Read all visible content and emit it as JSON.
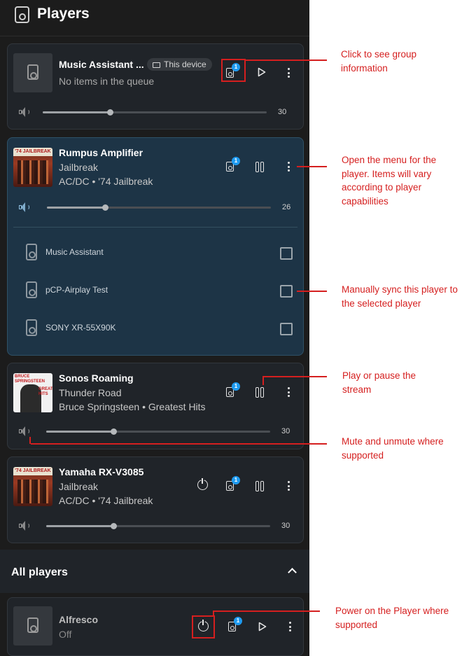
{
  "header": {
    "title": "Players",
    "icon": "speaker-icon"
  },
  "cards": [
    {
      "id": "ma",
      "name": "Music Assistant ...",
      "chip": "This device",
      "line2": "No items in the queue",
      "group_badge": "1",
      "volume": 30,
      "volume_text": "30",
      "state": "idle"
    },
    {
      "id": "rumpus",
      "name": "Rumpus Amplifier",
      "line2": "Jailbreak",
      "line3": "AC/DC • '74 Jailbreak",
      "group_badge": "1",
      "volume": 26,
      "volume_text": "26",
      "state": "playing",
      "art_text": "'74 JAILBREAK",
      "sync_players": [
        {
          "name": "Music Assistant",
          "checked": false
        },
        {
          "name": "pCP-Airplay Test",
          "checked": false
        },
        {
          "name": "SONY XR-55X90K",
          "checked": false
        }
      ]
    },
    {
      "id": "sonos",
      "name": "Sonos Roaming",
      "line2": "Thunder Road",
      "line3": "Bruce Springsteen • Greatest Hits",
      "group_badge": "1",
      "volume": 30,
      "volume_text": "30",
      "state": "playing",
      "art_text_1": "BRUCE SPRINGSTEEN",
      "art_text_2": "GREATEST HITS"
    },
    {
      "id": "yamaha",
      "name": "Yamaha RX-V3085",
      "line2": "Jailbreak",
      "line3": "AC/DC • '74 Jailbreak",
      "group_badge": "1",
      "volume": 30,
      "volume_text": "30",
      "state": "playing",
      "art_text": "'74 JAILBREAK"
    }
  ],
  "all_players": {
    "title": "All players",
    "expanded": true
  },
  "alfresco": {
    "name": "Alfresco",
    "status": "Off",
    "group_badge": "1"
  },
  "annotations": {
    "group": "Click to see group information",
    "menu": "Open the menu for the player. Items will vary according to player capabilities",
    "sync": "Manually sync this player to the selected player",
    "play": "Play or pause the stream",
    "mute": "Mute and unmute where supported",
    "power": "Power on the Player where supported"
  },
  "colors": {
    "annotation": "#d51f1f",
    "badge": "#1e9bf0",
    "background": "#1c1c1c",
    "selected_card": "#1d3446"
  }
}
